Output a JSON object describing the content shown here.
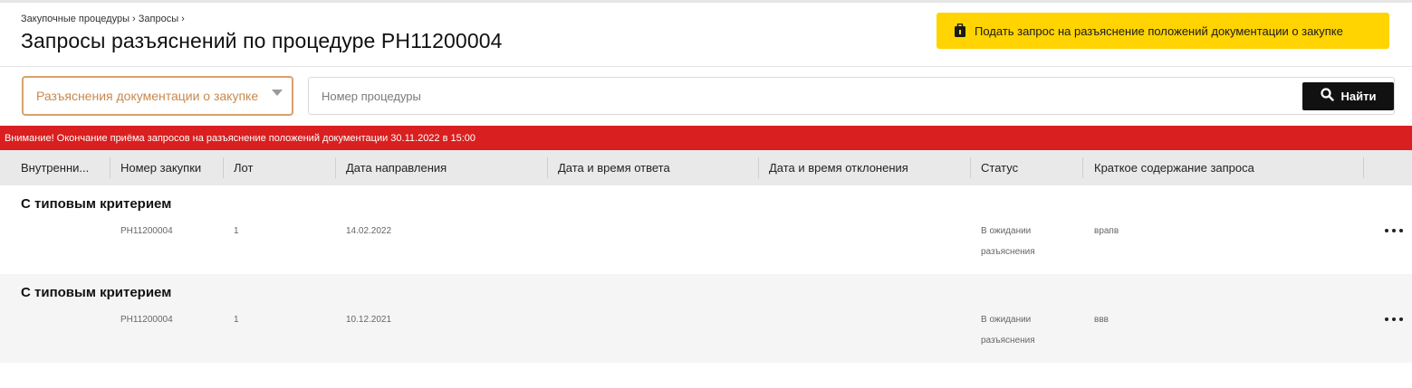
{
  "breadcrumb": "Закупочные процедуры › Запросы ›",
  "page_title": "Запросы разъяснений по процедуре РН11200004",
  "action_button": {
    "label": "Подать запрос на разъяснение положений документации о закупке",
    "icon": "document-lock-icon"
  },
  "filter": {
    "selected": "Разъяснения документации о закупке"
  },
  "search": {
    "placeholder": "Номер процедуры",
    "button_label": "Найти",
    "icon": "search-icon"
  },
  "alert": {
    "text": "Внимание! Окончание приёма запросов на разъяснение положений документации 30.11.2022 в 15:00"
  },
  "table": {
    "columns": [
      "Внутренни...",
      "Номер закупки",
      "Лот",
      "Дата направления",
      "Дата и время ответа",
      "Дата и время отклонения",
      "Статус",
      "Краткое содержание запроса"
    ],
    "groups": [
      {
        "title": "С типовым критерием",
        "row": {
          "internal": "",
          "number": "РН11200004",
          "lot": "1",
          "sent_date": "14.02.2022",
          "answer_date": "",
          "reject_date": "",
          "status_line1": "В ожидании",
          "status_line2": "разъяснения",
          "summary": "врапв"
        }
      },
      {
        "title": "С типовым критерием",
        "row": {
          "internal": "",
          "number": "РН11200004",
          "lot": "1",
          "sent_date": "10.12.2021",
          "answer_date": "",
          "reject_date": "",
          "status_line1": "В ожидании",
          "status_line2": "разъяснения",
          "summary": "ввв"
        }
      }
    ]
  },
  "colors": {
    "accent_yellow": "#ffd400",
    "alert_red": "#d91f1f",
    "filter_orange": "#d9a16a"
  }
}
